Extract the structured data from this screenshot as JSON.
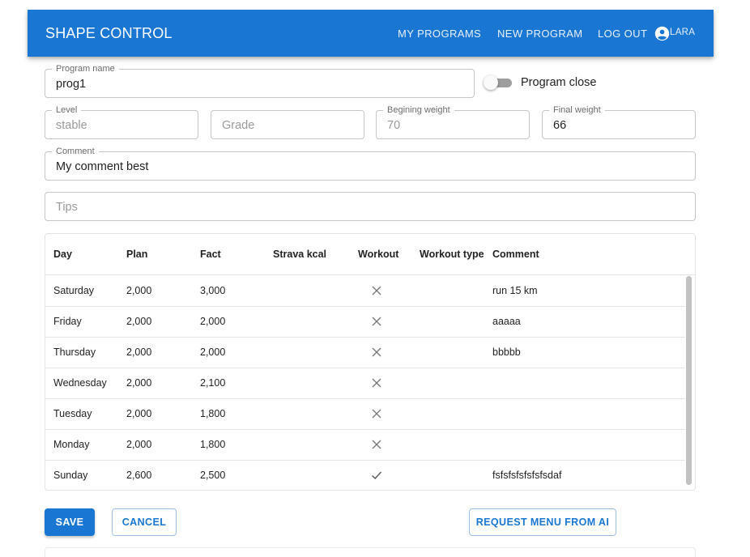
{
  "header": {
    "brand": "SHAPE CONTROL",
    "nav": {
      "my_programs": "MY PROGRAMS",
      "new_program": "NEW PROGRAM",
      "log_out": "LOG OUT"
    },
    "user": "LARA"
  },
  "form": {
    "program_name": {
      "label": "Program name",
      "value": "prog1"
    },
    "program_close": {
      "label": "Program close",
      "checked": false
    },
    "level": {
      "label": "Level",
      "value": "stable"
    },
    "grade": {
      "placeholder": "Grade"
    },
    "begining_weight": {
      "label": "Begining weight",
      "value": "70"
    },
    "final_weight": {
      "label": "Final weight",
      "value": "66"
    },
    "comment": {
      "label": "Comment",
      "value": "My comment best"
    },
    "tips": {
      "placeholder": "Tips"
    }
  },
  "table": {
    "columns": [
      "Day",
      "Plan",
      "Fact",
      "Strava kcal",
      "Workout",
      "Workout type",
      "Comment"
    ],
    "rows": [
      {
        "day": "Saturday",
        "plan": "2,000",
        "fact": "3,000",
        "strava": "",
        "workout": "cross",
        "type": "",
        "comment": "run 15 km"
      },
      {
        "day": "Friday",
        "plan": "2,000",
        "fact": "2,000",
        "strava": "",
        "workout": "cross",
        "type": "",
        "comment": "aaaaa"
      },
      {
        "day": "Thursday",
        "plan": "2,000",
        "fact": "2,000",
        "strava": "",
        "workout": "cross",
        "type": "",
        "comment": "bbbbb"
      },
      {
        "day": "Wednesday",
        "plan": "2,000",
        "fact": "2,100",
        "strava": "",
        "workout": "cross",
        "type": "",
        "comment": ""
      },
      {
        "day": "Tuesday",
        "plan": "2,000",
        "fact": "1,800",
        "strava": "",
        "workout": "cross",
        "type": "",
        "comment": ""
      },
      {
        "day": "Monday",
        "plan": "2,000",
        "fact": "1,800",
        "strava": "",
        "workout": "cross",
        "type": "",
        "comment": ""
      },
      {
        "day": "Sunday",
        "plan": "2,600",
        "fact": "2,500",
        "strava": "",
        "workout": "check",
        "type": "",
        "comment": "fsfsfsfsfsfsfsdaf"
      }
    ]
  },
  "actions": {
    "save": "SAVE",
    "cancel": "CANCEL",
    "request_menu": "REQUEST MENU FROM AI"
  },
  "colors": {
    "primary": "#1976d2"
  }
}
